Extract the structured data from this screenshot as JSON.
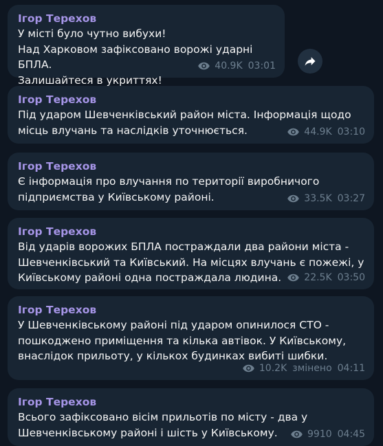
{
  "messages": [
    {
      "author": "Ігор Терехов",
      "text": "У місті було чутно вибухи!\nНад Харковом зафіксовано ворожі ударні БПЛА.\nЗалишайтеся в укриттях!",
      "views": "40.9K",
      "edited": "",
      "time": "03:01"
    },
    {
      "author": "Ігор Терехов",
      "text": "Під ударом Шевченківський район міста. Інформація щодо\nмісць влучань та наслідків уточнюється.",
      "views": "44.9K",
      "edited": "",
      "time": "03:10"
    },
    {
      "author": "Ігор Терехов",
      "text": "Є інформація про влучання по території виробничого\nпідприємства у Київському районі.",
      "views": "33.5K",
      "edited": "",
      "time": "03:27"
    },
    {
      "author": "Ігор Терехов",
      "text": "Від ударів ворожих БПЛА постраждали два райони міста -\nШевченківський та Київський. На місцях влучань є пожежі, у\nКиївському районі одна постраждала людина.",
      "views": "22.5K",
      "edited": "",
      "time": "03:50"
    },
    {
      "author": "Ігор Терехов",
      "text": "У Шевченківському районі під ударом опинилося СТО -\nпошкоджено приміщення та кілька автівок. У Київському,\nвнаслідок прильоту, у кількох будинках вибиті шибки.",
      "views": "10.2K",
      "edited": "змінено",
      "time": "04:11"
    },
    {
      "author": "Ігор Терехов",
      "text": "Всього зафіксовано вісім прильотів  по місту - два у\nШевченківському районі і шість у Київському.",
      "views": "9910",
      "edited": "",
      "time": "04:45"
    }
  ],
  "icons": {
    "views": "eye-icon",
    "share": "share-arrow-icon"
  },
  "colors": {
    "background": "#0e1621",
    "bubble": "#182533",
    "author": "#a695e7",
    "text": "#f5f5f5",
    "meta": "#6d7f8f",
    "share_button": "#213040"
  }
}
